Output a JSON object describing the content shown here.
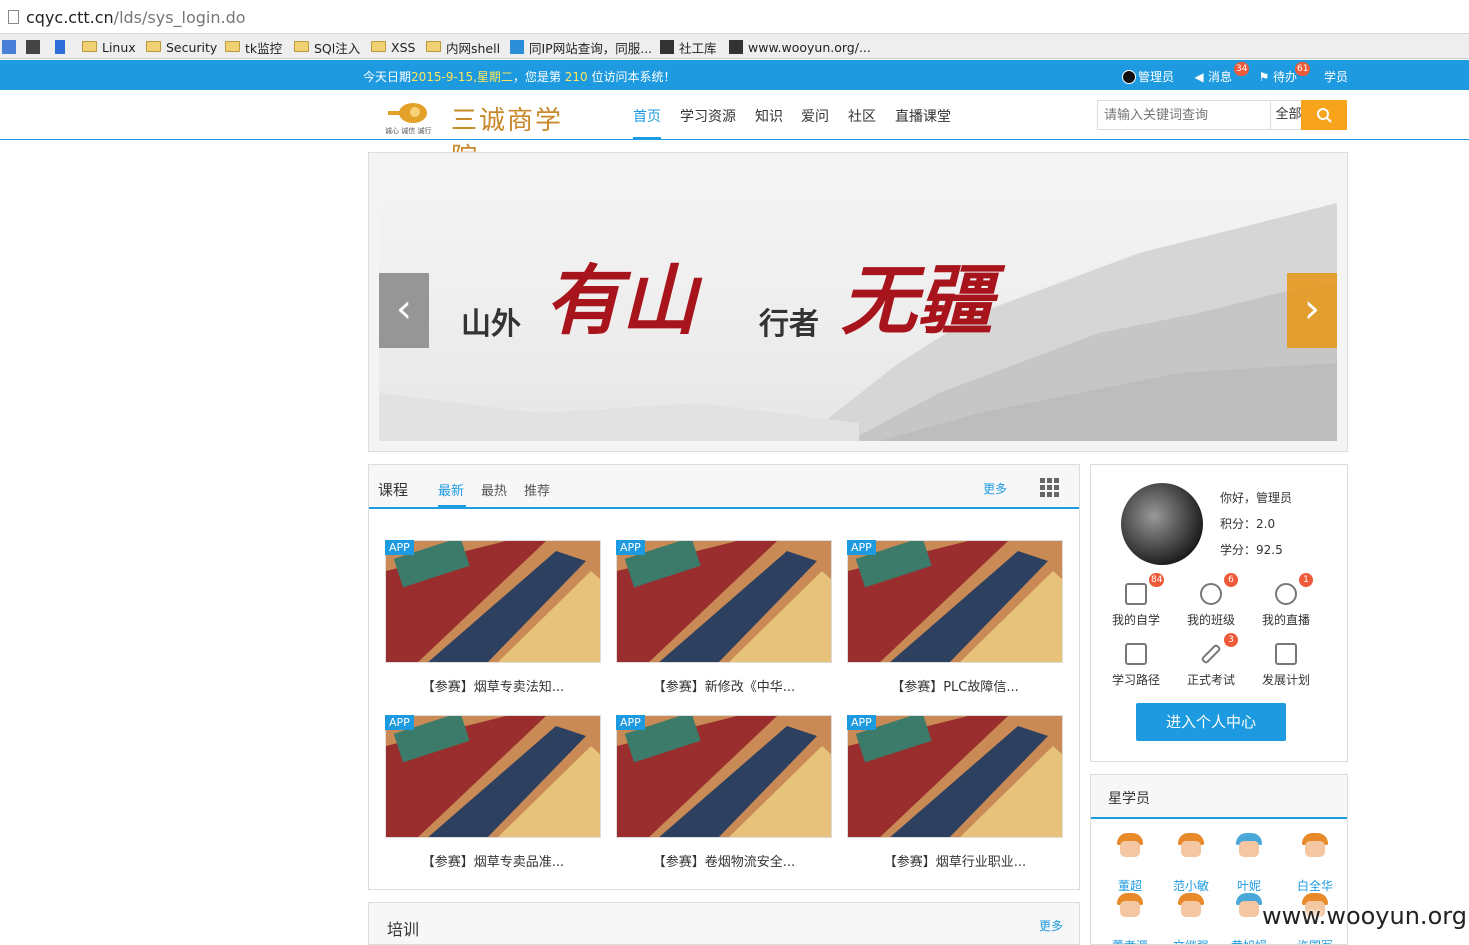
{
  "browser": {
    "url_host": "cqyc.ctt.cn",
    "url_path": "/lds/sys_login.do",
    "bookmarks": [
      "Linux",
      "Security",
      "tk监控",
      "SQl注入",
      "XSS",
      "内网shell",
      "同IP网站查询，同服...",
      "社工库",
      "www.wooyun.org/..."
    ]
  },
  "topbar": {
    "notice_prefix": "今天日期",
    "date": "2015-9-15,星期二",
    "notice_mid": "，您是第 ",
    "visitor": "210",
    "notice_suffix": " 位访问本系统！",
    "admin": "管理员",
    "messages": "消息",
    "messages_count": "34",
    "todo": "待办",
    "todo_count": "61",
    "student": "学员"
  },
  "header": {
    "logo_text": "三诚商学院",
    "logo_sub": "诚心 诚信 诚行",
    "nav": [
      "首页",
      "学习资源",
      "知识",
      "爱问",
      "社区",
      "直播课堂"
    ],
    "search_placeholder": "请输入关键词查询",
    "search_scope": "全部"
  },
  "banner": {
    "left_text": "山外",
    "left_callig": "有山",
    "right_text": "行者",
    "right_callig": "无疆"
  },
  "course": {
    "title": "课程",
    "tabs": [
      "最新",
      "最热",
      "推荐"
    ],
    "more": "更多",
    "tag": "APP",
    "items": [
      "【参赛】烟草专卖法知...",
      "【参赛】新修改《中华...",
      "【参赛】PLC故障信...",
      "【参赛】烟草专卖品准...",
      "【参赛】卷烟物流安全...",
      "【参赛】烟草行业职业..."
    ]
  },
  "profile": {
    "greeting": "你好，管理员",
    "points": "积分：2.0",
    "credits": "学分：92.5",
    "quick": [
      {
        "label": "我的自学",
        "badge": "84"
      },
      {
        "label": "我的班级",
        "badge": "6"
      },
      {
        "label": "我的直播",
        "badge": "1"
      },
      {
        "label": "学习路径",
        "badge": ""
      },
      {
        "label": "正式考试",
        "badge": "3"
      },
      {
        "label": "发展计划",
        "badge": ""
      }
    ],
    "enter": "进入个人中心"
  },
  "stars": {
    "title": "星学员",
    "names": [
      "董超",
      "范小敏",
      "叶妮",
      "白全华",
      "董孝源",
      "文继强",
      "黄旭娟",
      "许国军"
    ]
  },
  "training": {
    "title": "培训",
    "more": "更多"
  },
  "watermark": "www.wooyun.org",
  "colors": {
    "brand_blue": "#1e9be0",
    "accent_orange": "#f7a31c",
    "badge_red": "#ef5b3a"
  }
}
